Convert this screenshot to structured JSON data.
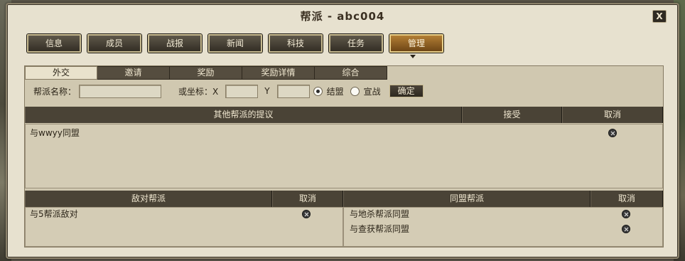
{
  "window": {
    "title": "帮派 - abc004",
    "close_label": "X"
  },
  "main_tabs": [
    {
      "label": "信息"
    },
    {
      "label": "成员"
    },
    {
      "label": "战报"
    },
    {
      "label": "新闻"
    },
    {
      "label": "科技"
    },
    {
      "label": "任务"
    },
    {
      "label": "管理",
      "active": true
    }
  ],
  "sub_tabs": [
    {
      "label": "外交",
      "active": true
    },
    {
      "label": "邀请"
    },
    {
      "label": "奖励"
    },
    {
      "label": "奖励详情"
    },
    {
      "label": "综合"
    }
  ],
  "form": {
    "name_label": "帮派名称：",
    "name_value": "",
    "coord_label": "或坐标：X",
    "x_value": "",
    "y_label": "Y",
    "y_value": "",
    "alliance_label": "结盟",
    "alliance_checked": true,
    "war_label": "宣战",
    "war_checked": false,
    "confirm_label": "确定"
  },
  "proposals": {
    "header_title": "其他帮派的提议",
    "header_accept": "接受",
    "header_cancel": "取消",
    "rows": [
      {
        "text": "与wwyy同盟",
        "cancel_icon": "cancel-icon"
      }
    ]
  },
  "hostile": {
    "header_title": "敌对帮派",
    "header_cancel": "取消",
    "rows": [
      {
        "text": "与5帮派敌对",
        "cancel_icon": "cancel-icon"
      }
    ]
  },
  "allied": {
    "header_title": "同盟帮派",
    "header_cancel": "取消",
    "rows": [
      {
        "text": "与地杀帮派同盟",
        "cancel_icon": "cancel-icon"
      },
      {
        "text": "与查获帮派同盟",
        "cancel_icon": "cancel-icon"
      }
    ]
  }
}
